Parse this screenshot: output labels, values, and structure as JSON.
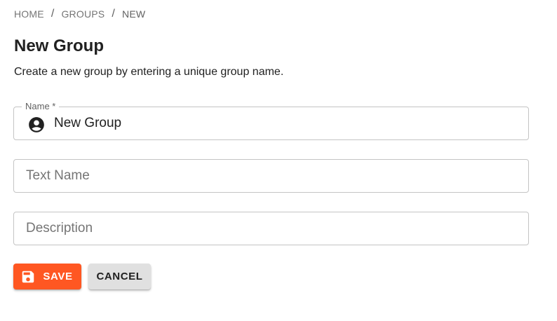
{
  "breadcrumb": {
    "items": [
      {
        "label": "HOME"
      },
      {
        "label": "GROUPS"
      },
      {
        "label": "NEW"
      }
    ],
    "separator": "/"
  },
  "header": {
    "title": "New Group",
    "description": "Create a new group by entering a unique group name."
  },
  "form": {
    "name": {
      "label": "Name *",
      "value": "New Group",
      "icon": "account-circle-icon"
    },
    "text_name": {
      "placeholder": "Text Name",
      "value": ""
    },
    "description": {
      "placeholder": "Description",
      "value": ""
    }
  },
  "actions": {
    "save_label": "SAVE",
    "save_icon": "save-icon",
    "cancel_label": "CANCEL"
  },
  "colors": {
    "accent": "#ff5722",
    "secondary_button": "#e0e0e0",
    "border": "#c4c4c4"
  }
}
